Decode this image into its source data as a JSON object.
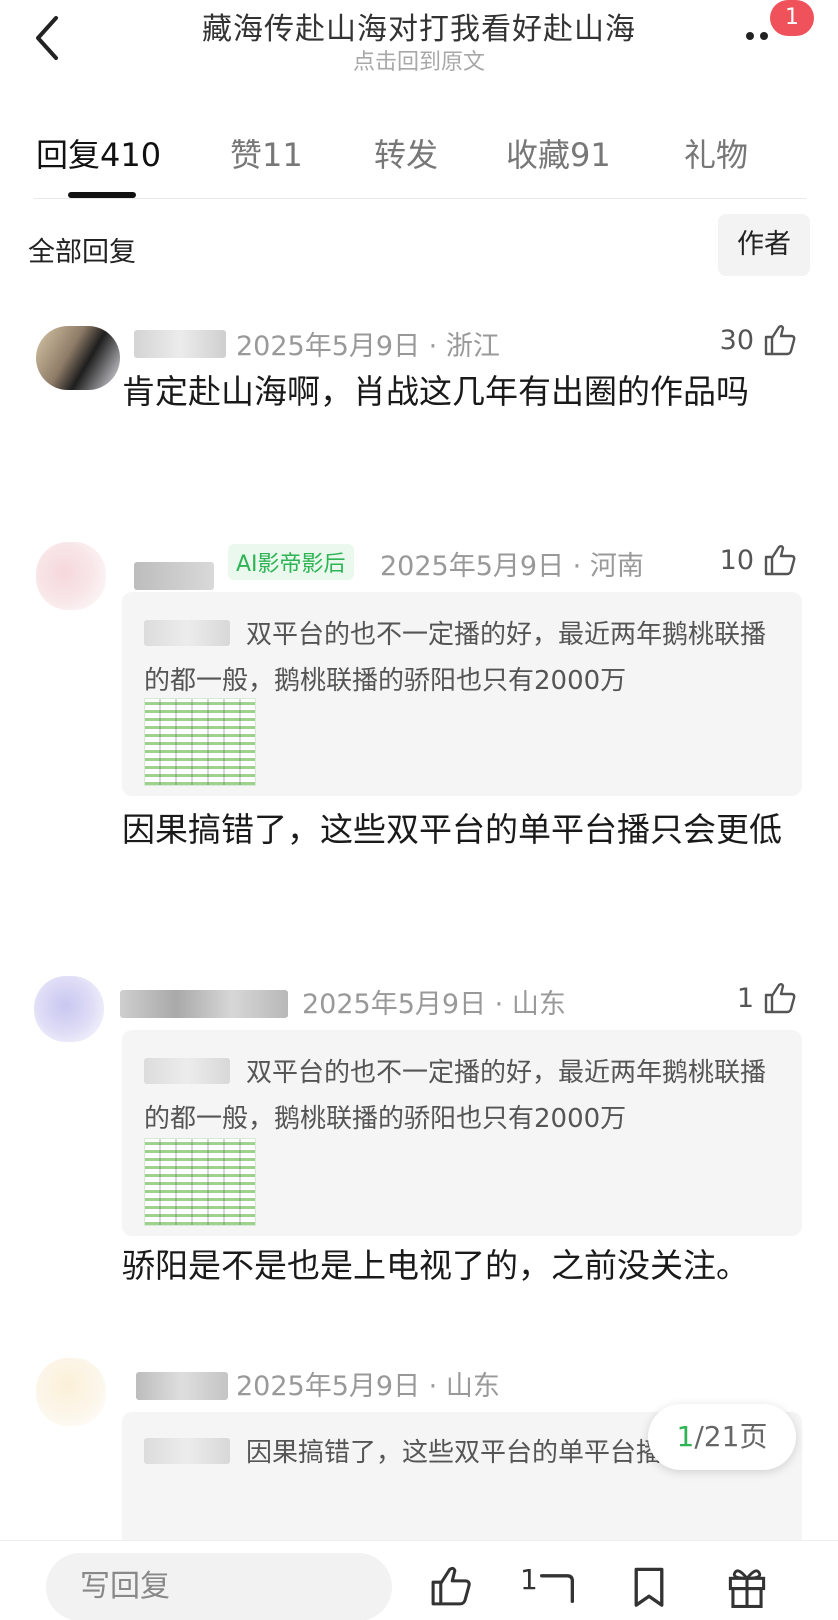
{
  "header": {
    "title": "藏海传赴山海对打我看好赴山海",
    "subtitle": "点击回到原文",
    "badge_count": "1"
  },
  "tabs": [
    {
      "label": "回复",
      "count": "410",
      "active": true
    },
    {
      "label": "赞",
      "count": "11",
      "active": false
    },
    {
      "label": "转发",
      "count": "",
      "active": false
    },
    {
      "label": "收藏",
      "count": "91",
      "active": false
    },
    {
      "label": "礼物",
      "count": "",
      "active": false
    }
  ],
  "filter": {
    "all_label": "全部回复",
    "author_label": "作者"
  },
  "comments": [
    {
      "meta": "2025年5月9日 · 浙江",
      "likes": "30",
      "content": "肯定赴山海啊，肖战这几年有出圈的作品吗"
    },
    {
      "badge": "AI影帝影后",
      "meta": "2025年5月9日 · 河南",
      "likes": "10",
      "quote": "双平台的也不一定播的好，最近两年鹅桃联播的都一般，鹅桃联播的骄阳也只有2000万",
      "content": "因果搞错了，这些双平台的单平台播只会更低"
    },
    {
      "meta": "2025年5月9日 · 山东",
      "likes": "1",
      "quote": "双平台的也不一定播的好，最近两年鹅桃联播的都一般，鹅桃联播的骄阳也只有2000万",
      "content": "骄阳是不是也是上电视了的，之前没关注。"
    },
    {
      "meta": "2025年5月9日 · 山东",
      "quote": "因果搞错了，这些双平台的单平台播只会更低"
    }
  ],
  "pagination": {
    "current": "1",
    "total": "/21页"
  },
  "bottom_bar": {
    "reply_placeholder": "写回复",
    "like_count": "1"
  }
}
